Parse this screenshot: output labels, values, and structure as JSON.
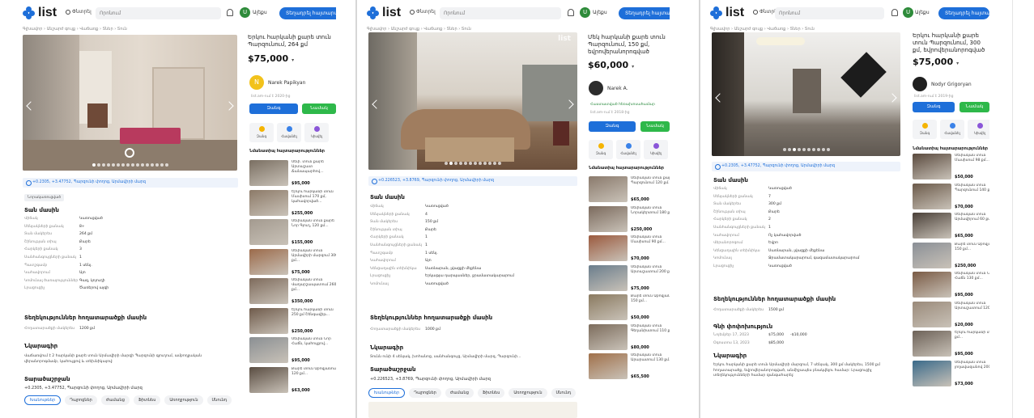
{
  "header": {
    "logo": "list",
    "search_label": "Փնտրել",
    "search_placeholder": "Որոնում",
    "account": "Ալեքս",
    "post_ad": "Տեղադրել հայտարարություն",
    "avatar_letter": "U"
  },
  "crumbs": "Գլխավոր › Անշարժ գույք › Վաճառք › Տներ › Տուն",
  "panel1": {
    "title": "Երկու հարկանի քարե տուն Պարզունում, 264 քմ",
    "price": "$75,000",
    "seller_name": "Narek Papikyan",
    "seller_letter": "N",
    "since": "list.am-ում է 2020-ից",
    "call": "Զանգ",
    "message": "Նամակ",
    "actions": [
      "Զանգ",
      "Հավանել",
      "Կիսվել"
    ],
    "similar_title": "Նմանատիպ հայտարարություններ",
    "similar": [
      {
        "text": "Սեփ. տուն քարե Արտաշատ Ճանապարհով...",
        "price": "$95,000"
      },
      {
        "text": "Երկու հարկանի տուն Մասիսում 170 քմ, կահավորված...",
        "price": "$255,000"
      },
      {
        "text": "Սեփական տուն քարե Նոր Գյուղ, 120 քմ...",
        "price": "$155,000"
      },
      {
        "text": "Սեփական տուն Արմավիրի մարզում 300 քմ...",
        "price": "$75,000"
      },
      {
        "text": "Սեփական տուն Վաղարշապատում 260 քմ...",
        "price": "$350,000"
      },
      {
        "text": "Երկու հարկանի տուն 250 քմ Շենգավիթ...",
        "price": "$250,000"
      },
      {
        "text": "Սեփական տուն Նոր Հաճն, կահույքով...",
        "price": "$95,000"
      },
      {
        "text": "Քարե տուն Աբովյանում 120 քմ...",
        "price": "$63,000"
      }
    ],
    "address": "+0.2305, +3.47752, Պարզունի փողոց, Արմավիրի մարզ",
    "tag": "Նորակառուցված",
    "about_h": "Տան մասին",
    "specs": [
      [
        "Վիճակ",
        "Կառուցված"
      ],
      [
        "Սենյակների քանակ",
        "8+"
      ],
      [
        "Տան մակերես",
        "264 քմ"
      ],
      [
        "Շինության տիպ",
        "Քարե"
      ],
      [
        "Հարկերի քանակ",
        "3"
      ],
      [
        "Սանհանգույցների քանակ",
        "1"
      ],
      [
        "Պատշգամբ",
        "1 սենյ."
      ],
      [
        "Կահավորում",
        "Այո"
      ],
      [
        "Կոմունալ ծառայություններ",
        "Գազ, կոյուղի"
      ],
      [
        "Լրացուցիչ",
        "Ծառերով այգի"
      ]
    ],
    "land_h": "Տեղեկություններ հողատարածքի մասին",
    "land": [
      [
        "Հողատարածքի մակերես",
        "1200 քմ"
      ]
    ],
    "desc_h": "Նկարագիր",
    "desc": "Վաճառվում է 2 հարկանի քարե տուն Արմավիրի մարզի Պարզունի գյուղում, ամբողջական վերանորոգմամբ, կահույքով և տեխնիկայով:",
    "contact_h": "Տարածաշրջան",
    "contact": "+0.2305, +3.47752, Պարզունի փողոց, Արմավիրի մարզ",
    "tabs": [
      "Խանութներ",
      "Դպրոցներ",
      "Ժամանց",
      "Ֆիտնես",
      "Առողջություն",
      "Սնունդ"
    ]
  },
  "panel2": {
    "title": "Մեկ հարկանի քարե տուն Պարզունում, 150 քմ, եվրովերանորոգված",
    "price": "$60,000",
    "seller_name": "Narek A.",
    "since": "list.am-ում է 2018-ից",
    "verified": "Հաստատված հեռախոսահամար",
    "call": "Զանգ",
    "message": "Նամակ",
    "actions": [
      "Զանգ",
      "Հավանել",
      "Կիսվել"
    ],
    "similar_title": "Նմանատիպ հայտարարություններ",
    "similar": [
      {
        "text": "Սեփական տուն քարե Պարզունում 120 քմ...",
        "price": "$65,000"
      },
      {
        "text": "Սեփական տուն Նորակերտում 180 քմ...",
        "price": "$250,000"
      },
      {
        "text": "Սեփական տուն Մասիսում 90 քմ...",
        "price": "$70,000"
      },
      {
        "text": "Սեփական տուն Արտաշատում 200 քմ...",
        "price": "$75,000"
      },
      {
        "text": "Քարե տուն Աբովյանում 150 քմ...",
        "price": "$50,000"
      },
      {
        "text": "Սեփական տուն Գեղանիստում 110 քմ...",
        "price": "$80,000"
      },
      {
        "text": "Սեփական տուն Արարատում 130 քմ...",
        "price": "$65,500"
      }
    ],
    "address": "+0.226523, +3.8769, Պարզունի փողոց, Արմավիրի մարզ",
    "about_h": "Տան մասին",
    "specs": [
      [
        "Վիճակ",
        "Կառուցված"
      ],
      [
        "Սենյակների քանակ",
        "4"
      ],
      [
        "Տան մակերես",
        "150 քմ"
      ],
      [
        "Շինության տիպ",
        "Քարե"
      ],
      [
        "Հարկերի քանակ",
        "1"
      ],
      [
        "Սանհանգույցների քանակ",
        "1"
      ],
      [
        "Պատշգամբ",
        "1 սենյ."
      ],
      [
        "Կահավորում",
        "Այո"
      ],
      [
        "Կենցաղային տեխնիկա",
        "Սառնարան, լվացքի մեքենա"
      ],
      [
        "Լրացուցիչ",
        "Երկաթյա դարպասներ, ջրամատակարարում"
      ],
      [
        "Կոմունալ",
        "Կառուցված"
      ]
    ],
    "land_h": "Տեղեկություններ հողատարածքի մասին",
    "land": [
      [
        "Հողատարածքի մակերես",
        "1000 քմ"
      ]
    ],
    "desc_h": "Նկարագիր",
    "desc": "Տունն ունի 4 սենյակ, խոհանոց, սանհանգույց, Արմավիրի մարզ, Պարզունի...",
    "contact_h": "Տարածաշրջան",
    "contact": "+0.226523, +3.8769, Պարզունի փողոց, Արմավիրի մարզ",
    "tabs": [
      "Խանութներ",
      "Դպրոցներ",
      "Ժամանց",
      "Ֆիտնես",
      "Առողջություն",
      "Սնունդ"
    ]
  },
  "panel3": {
    "title": "Երկու հարկանի քարե տուն Պարզունում, 300 քմ, եվրովերանորոգված",
    "price": "$75,000",
    "seller_name": "Nodyr Grigoryan",
    "since": "list.am-ում է 2019-ից",
    "call": "Զանգ",
    "message": "Նամակ",
    "actions": [
      "Զանգ",
      "Հավանել",
      "Կիսվել"
    ],
    "similar_title": "Նմանատիպ հայտարարություններ",
    "similar": [
      {
        "text": "Սեփական տուն Մասիսում 98 քմ...",
        "price": "$50,000"
      },
      {
        "text": "Սեփական տուն Պարզունում 140 քմ...",
        "price": "$70,000"
      },
      {
        "text": "Սեփական տուն Արմավիրում 60 քմ...",
        "price": "$65,000"
      },
      {
        "text": "Քարե տուն Աբովյանում 150 քմ...",
        "price": "$250,000"
      },
      {
        "text": "Սեփական տուն Նոր Հաճն 130 քմ...",
        "price": "$95,000"
      },
      {
        "text": "Սեփական տուն Արտաշատում 120 քմ...",
        "price": "$20,000"
      },
      {
        "text": "Երկու հարկանի տուն 98 քմ...",
        "price": "$95,000"
      },
      {
        "text": "Սեփական տուն լողավազանով 200 քմ...",
        "price": "$73,000"
      }
    ],
    "address": "+0.2305, +3.47752, Պարզունի փողոց, Արմավիրի մարզ",
    "about_h": "Տան մասին",
    "specs": [
      [
        "Վիճակ",
        "Կառուցված"
      ],
      [
        "Սենյակների քանակ",
        "7"
      ],
      [
        "Տան մակերես",
        "300 քմ"
      ],
      [
        "Շինության տիպ",
        "Քարե"
      ],
      [
        "Հարկերի քանակ",
        "2"
      ],
      [
        "Սանհանգույցների քանակ",
        "1"
      ],
      [
        "Կահավորում",
        "Ոչ կահավորված"
      ],
      [
        "Վերանորոգում",
        "Եվրո"
      ],
      [
        "Կենցաղային տեխնիկա",
        "Սառնարան, լվացքի մեքենա"
      ],
      [
        "Կոմունալ",
        "Ջրամատակարարում, գազամատակարարում"
      ],
      [
        "Լրացուցիչ",
        "Կառուցված"
      ]
    ],
    "land_h": "Տեղեկություններ հողատարածքի մասին",
    "land": [
      [
        "Հողատարածքի մակերես",
        "1500 քմ"
      ]
    ],
    "history_h": "Գնի փոփոխություն",
    "history": [
      [
        "Նոյեմբեր 17, 2023",
        "$75,000",
        "-$10,000"
      ],
      [
        "Օգոստոս 13, 2023",
        "$85,000",
        ""
      ]
    ],
    "desc_h": "Նկարագիր",
    "desc": "Երկու հարկանի քարե տուն Արմավիրի մարզում, 7 սենյակ, 300 քմ մակերես, 1500 քմ հողատարածք, եվրովերանորոգված, անմիջապես բնակվելու համար: Լրացուցիչ տեղեկությունների համար զանգահարել:"
  }
}
